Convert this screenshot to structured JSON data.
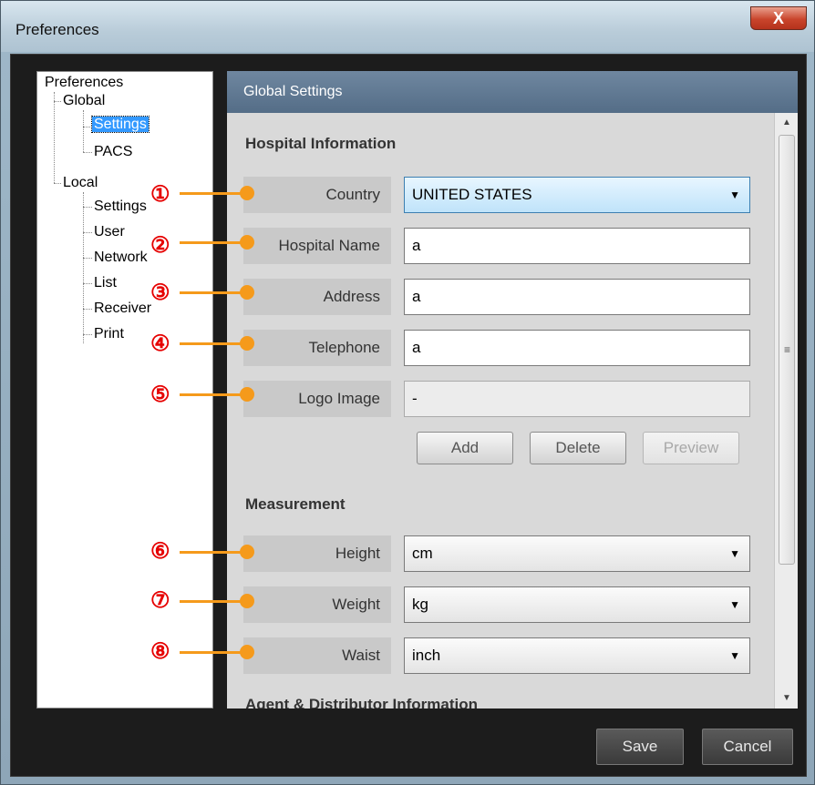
{
  "window": {
    "title": "Preferences",
    "close_glyph": "X"
  },
  "tree": {
    "root": "Preferences",
    "global": "Global",
    "global_children": [
      "Settings",
      "PACS"
    ],
    "local": "Local",
    "local_children": [
      "Settings",
      "User",
      "Network",
      "List",
      "Receiver",
      "Print"
    ],
    "selected": "Settings"
  },
  "panel": {
    "header": "Global Settings",
    "hospital_section": "Hospital Information",
    "fields": {
      "country": {
        "label": "Country",
        "value": "UNITED STATES"
      },
      "hospital_name": {
        "label": "Hospital Name",
        "value": "a"
      },
      "address": {
        "label": "Address",
        "value": "a"
      },
      "telephone": {
        "label": "Telephone",
        "value": "a"
      },
      "logo_image": {
        "label": "Logo Image",
        "value": "-"
      }
    },
    "logo_buttons": {
      "add": "Add",
      "delete": "Delete",
      "preview": "Preview"
    },
    "measurement_section": "Measurement",
    "measurement": {
      "height": {
        "label": "Height",
        "value": "cm"
      },
      "weight": {
        "label": "Weight",
        "value": "kg"
      },
      "waist": {
        "label": "Waist",
        "value": "inch"
      }
    },
    "agent_section": "Agent & Distributor Information",
    "dropdown_arrow": "▼"
  },
  "callouts": [
    "①",
    "②",
    "③",
    "④",
    "⑤",
    "⑥",
    "⑦",
    "⑧"
  ],
  "callout_color": "#e60000",
  "leader_color": "#f59a1b",
  "scrollbar": {
    "up": "▲",
    "down": "▼",
    "grip": "≡"
  },
  "footer": {
    "save": "Save",
    "cancel": "Cancel"
  }
}
